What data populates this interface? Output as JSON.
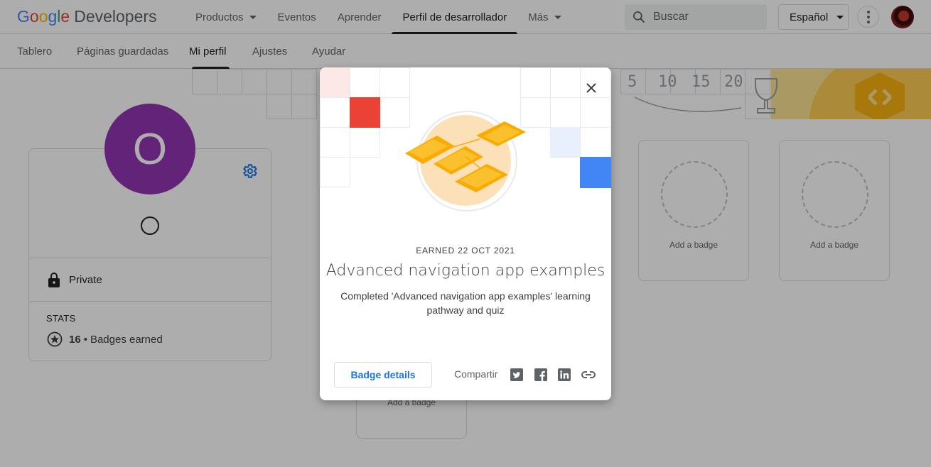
{
  "header": {
    "logo": {
      "google": "Google",
      "developers": "Developers"
    },
    "nav": [
      "Productos",
      "Eventos",
      "Aprender",
      "Perfil de desarrollador",
      "Más"
    ],
    "search_placeholder": "Buscar",
    "language": "Español"
  },
  "subnav": [
    "Tablero",
    "Páginas guardadas",
    "Mi perfil",
    "Ajustes",
    "Ayudar"
  ],
  "profile": {
    "initial": "O",
    "privacy": "Private",
    "stats_label": "STATS",
    "badges_count": "16",
    "badges_label": "Badges earned"
  },
  "badge_slots": {
    "add_label": "Add a badge"
  },
  "strip_numbers": [
    "5",
    "10",
    "15",
    "20"
  ],
  "modal": {
    "earned": "EARNED 22 OCT 2021",
    "title": "Advanced navigation app examples",
    "description": "Completed 'Advanced navigation app examples' learning pathway and quiz",
    "details_button": "Badge details",
    "share_label": "Compartir",
    "share_icons": [
      "twitter-icon",
      "facebook-icon",
      "linkedin-icon",
      "link-icon"
    ]
  },
  "colors": {
    "accent": "#1a73e8",
    "avatar": "#9334b3",
    "badge_orange": "#f9ab00"
  }
}
